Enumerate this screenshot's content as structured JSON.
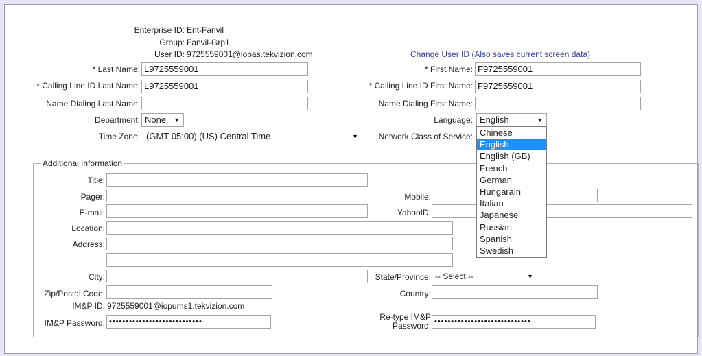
{
  "info": {
    "enterprise_label": "Enterprise ID:",
    "enterprise_value": "Ent-Fanvil",
    "group_label": "Group:",
    "group_value": "Fanvil-Grp1",
    "user_label": "User ID:",
    "user_value": "9725559001@iopas.tekvizion.com",
    "change_user_link": "Change User ID (Also saves current screen data)"
  },
  "names": {
    "last_name_label": "* Last Name:",
    "last_name_value": "L9725559001",
    "first_name_label": "* First Name:",
    "first_name_value": "F9725559001",
    "cli_last_label": "* Calling Line ID Last Name:",
    "cli_last_value": "L9725559001",
    "cli_first_label": "* Calling Line ID First Name:",
    "cli_first_value": "F9725559001",
    "dial_last_label": "Name Dialing Last Name:",
    "dial_last_value": "",
    "dial_first_label": "Name Dialing First Name:",
    "dial_first_value": ""
  },
  "settings": {
    "department_label": "Department:",
    "department_value": "None",
    "language_label": "Language:",
    "language_value": "English",
    "timezone_label": "Time Zone:",
    "timezone_value": "(GMT-05:00) (US) Central Time",
    "ncos_label": "Network Class of Service:"
  },
  "language_options": [
    "Chinese",
    "English",
    "English (GB)",
    "French",
    "German",
    "Hungarain",
    "Italian",
    "Japanese",
    "Russian",
    "Spanish",
    "Swedish"
  ],
  "language_selected_index": 1,
  "additional": {
    "legend": "Additional Information",
    "title_label": "Title:",
    "pager_label": "Pager:",
    "mobile_label": "Mobile:",
    "email_label": "E-mail:",
    "yahoo_label": "YahooID:",
    "location_label": "Location:",
    "address_label": "Address:",
    "city_label": "City:",
    "state_label": "State/Province:",
    "state_value": "-- Select --",
    "zip_label": "Zip/Postal Code:",
    "country_label": "Country:",
    "imp_id_label": "IM&P ID:",
    "imp_id_value": "9725559001@iopums1.tekvizion.com",
    "imp_pwd_label": "IM&P Password:",
    "imp_pwd_value": "••••••••••••••••••••••••••••",
    "retype_label_1": "Re-type IM&P",
    "retype_label_2": "Password:",
    "retype_pwd_value": "•••••••••••••••••••••••••••••"
  },
  "colors": {
    "background": "#e6e6f5",
    "link": "#33449a",
    "selection": "#1e90ff"
  }
}
